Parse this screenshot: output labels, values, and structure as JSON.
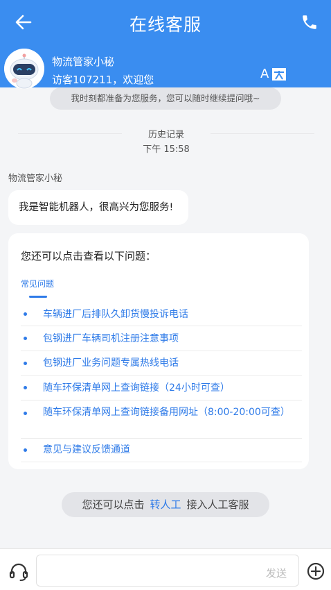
{
  "topbar": {
    "title": "在线客服"
  },
  "agent": {
    "name": "物流管家小秘",
    "greeting": "访客107211，欢迎您"
  },
  "welcome_notice": "我时刻都准备为您服务，您可以随时继续提问哦~",
  "history": {
    "label": "历史记录",
    "time": "下午 15:58"
  },
  "messages": {
    "sender": "物流管家小秘",
    "intro": "我是智能机器人，很高兴为您服务!",
    "card": {
      "title": "您还可以点击查看以下问题：",
      "tab": "常见问题",
      "questions": [
        "车辆进厂后排队久卸货慢投诉电话",
        "包钢进厂车辆司机注册注意事项",
        "包钢进厂业务问题专属热线电话",
        "随车环保清单网上查询链接（24小时可查）",
        "随车环保清单网上查询链接备用网址（8:00-20:00可查）",
        "意见与建议反馈通道"
      ]
    }
  },
  "handoff": {
    "prefix": "您还可以点击",
    "link": "转人工",
    "suffix": "接入人工客服"
  },
  "input": {
    "value": "",
    "send_label": "发送"
  },
  "icons": {
    "back": "arrow-left-icon",
    "phone": "phone-icon",
    "translate": "translate-icon",
    "headset": "headset-icon",
    "plus": "plus-circle-icon",
    "avatar": "robot-avatar"
  },
  "colors": {
    "brand": "#3a8df0",
    "link": "#2f7be8",
    "background": "#f4f5f7"
  }
}
